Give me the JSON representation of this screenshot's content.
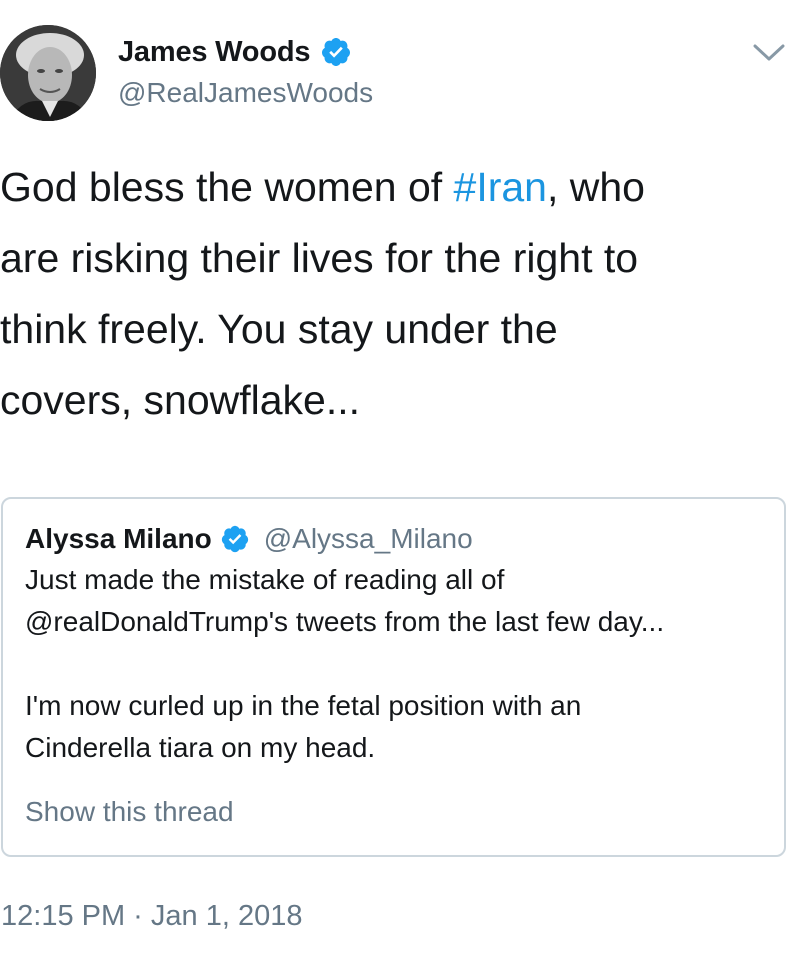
{
  "author": {
    "display_name": "James Woods",
    "handle": "@RealJamesWoods",
    "verified": true
  },
  "tweet": {
    "lines": [
      [
        "God bless the women of ",
        "#Iran",
        ", who"
      ],
      "are risking their lives for the right to",
      "think freely. You stay under the",
      "covers, snowflake..."
    ],
    "timestamp": "12:15 PM · Jan 1, 2018"
  },
  "quoted_tweet": {
    "display_name": "Alyssa Milano",
    "handle": "@Alyssa_Milano",
    "verified": true,
    "paragraph1": [
      "Just made the mistake of reading all of",
      "@realDonaldTrump's tweets from the last few day..."
    ],
    "paragraph2": [
      "I'm now curled up in the fetal position with an",
      "Cinderella tiara on my head."
    ],
    "thread_link": "Show this thread"
  },
  "colors": {
    "text": "#14171a",
    "secondary": "#657786",
    "link": "#1b95e0",
    "verified_badge": "#1da1f2",
    "border": "#ccd6dd"
  },
  "icons": {
    "verified": "verified-badge-icon",
    "more": "chevron-down-icon"
  }
}
